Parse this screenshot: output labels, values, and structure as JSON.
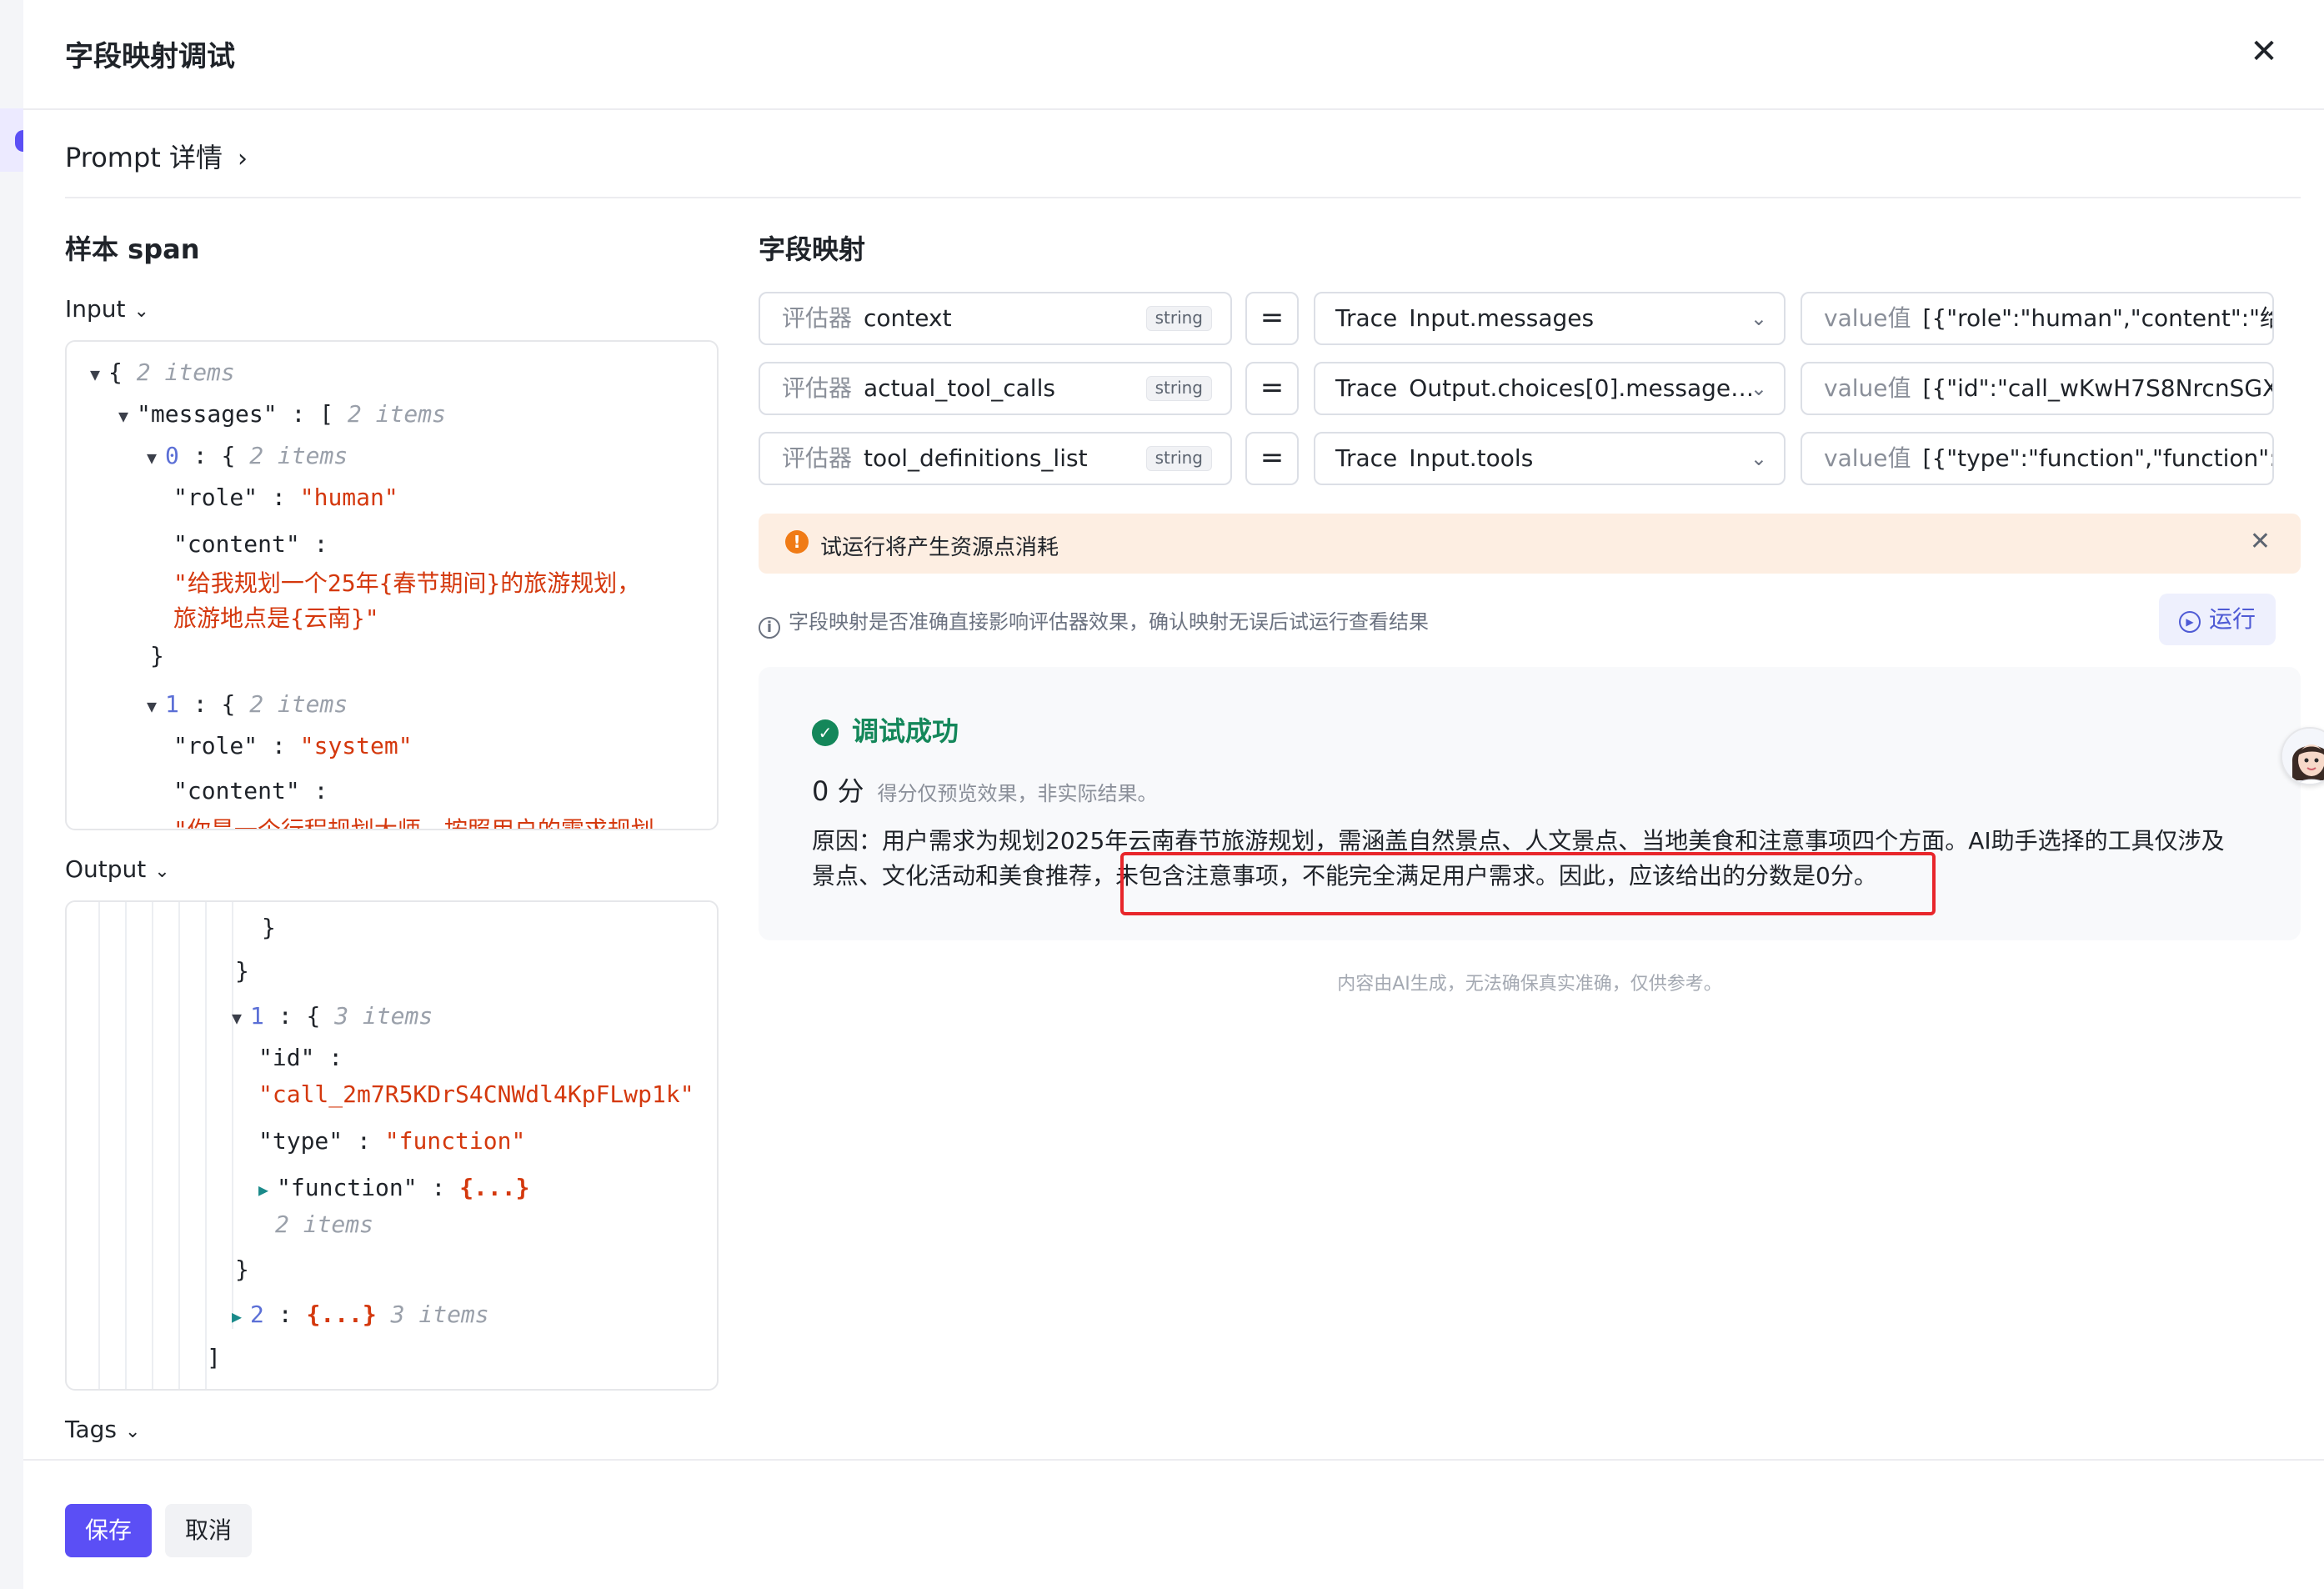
{
  "modal": {
    "title": "字段映射调试"
  },
  "prompt_link": {
    "label": "Prompt 详情"
  },
  "left": {
    "section_title": "样本 span",
    "input_label": "Input",
    "output_label": "Output",
    "tags_label": "Tags",
    "input_tree": {
      "root_count": "2 items",
      "messages_key": "\"messages\"",
      "messages_count": "2 items",
      "item0_index": "0",
      "item0_count": "2 items",
      "role_key": "\"role\"",
      "item0_role": "\"human\"",
      "content_key": "\"content\"",
      "item0_content_1": "\"给我规划一个25年{春节期间}的旅游规划，",
      "item0_content_2": "旅游地点是{云南}\"",
      "item1_index": "1",
      "item1_count": "2 items",
      "item1_role": "\"system\"",
      "item1_content_partial": "\"你是一个行程规划大师，按照用户的需求规划"
    },
    "output_tree": {
      "item1_index": "1",
      "item1_count": "3 items",
      "id_key": "\"id\"",
      "id_value": "\"call_2m7R5KDrS4CNWdl4KpFLwp1k\"",
      "type_key": "\"type\"",
      "type_value": "\"function\"",
      "function_key": "\"function\"",
      "function_collapsed": "{...}",
      "function_count": "2 items",
      "item2_index": "2",
      "item2_collapsed": "{...}",
      "item2_count": "3 items"
    }
  },
  "right": {
    "section_title": "字段映射",
    "mappings": [
      {
        "evaluator_label": "评估器",
        "field": "context",
        "type": "string",
        "eq": "=",
        "trace_label": "Trace",
        "trace_path": "Input.messages",
        "value_label": "value值",
        "value": "[{\"role\":\"human\",\"content\":\"给…"
      },
      {
        "evaluator_label": "评估器",
        "field": "actual_tool_calls",
        "type": "string",
        "eq": "=",
        "trace_label": "Trace",
        "trace_path": "Output.choices[0].message…",
        "value_label": "value值",
        "value": "[{\"id\":\"call_wKwH7S8NrcnSGX…"
      },
      {
        "evaluator_label": "评估器",
        "field": "tool_definitions_list",
        "type": "string",
        "eq": "=",
        "trace_label": "Trace",
        "trace_path": "Input.tools",
        "value_label": "value值",
        "value": "[{\"type\":\"function\",\"function\":{\"…"
      }
    ],
    "warning": "试运行将产生资源点消耗",
    "info": "字段映射是否准确直接影响评估器效果，确认映射无误后试运行查看结果",
    "run_label": "运行",
    "result": {
      "status": "调试成功",
      "score": "0 分",
      "score_note": "得分仅预览效果，非实际结果。",
      "reason": "原因：用户需求为规划2025年云南春节旅游规划，需涵盖自然景点、人文景点、当地美食和注意事项四个方面。AI助手选择的工具仅涉及景点、文化活动和美食推荐，未包含注意事项，不能完全满足用户需求。因此，应该给出的分数是0分。"
    },
    "ai_note": "内容由AI生成，无法确保真实准确，仅供参考。"
  },
  "footer": {
    "save_label": "保存",
    "cancel_label": "取消"
  },
  "colors": {
    "primary": "#5b4ff5",
    "success": "#14875a",
    "string": "#d4380d",
    "warning": "#f07b16",
    "highlight_border": "#e8262b"
  }
}
